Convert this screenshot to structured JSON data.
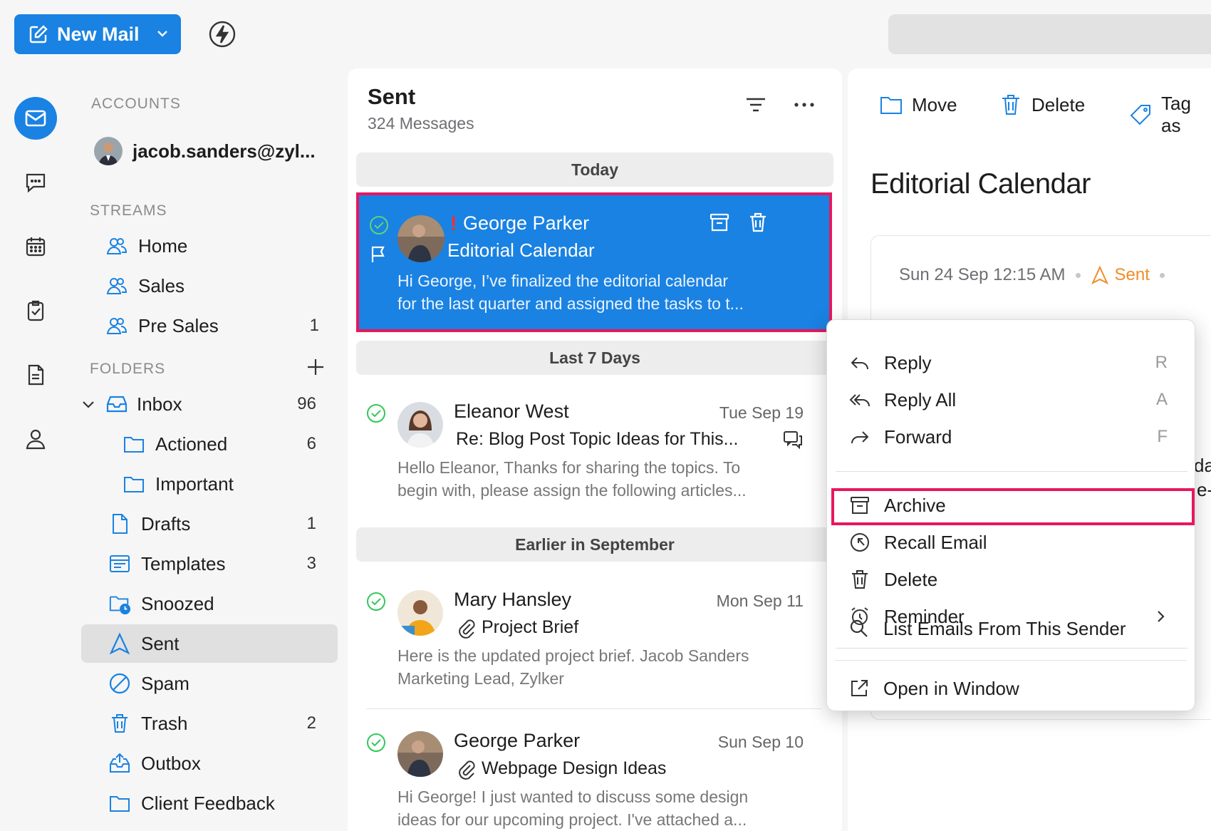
{
  "toolbar": {
    "new_mail_label": "New Mail"
  },
  "sidebar": {
    "accounts_header": "ACCOUNTS",
    "account_email": "jacob.sanders@zyl...",
    "streams_header": "STREAMS",
    "streams": [
      {
        "label": "Home",
        "count": ""
      },
      {
        "label": "Sales",
        "count": ""
      },
      {
        "label": "Pre Sales",
        "count": "1"
      }
    ],
    "folders_header": "FOLDERS",
    "folders": [
      {
        "label": "Inbox",
        "count": "96"
      },
      {
        "label": "Actioned",
        "count": "6"
      },
      {
        "label": "Important",
        "count": ""
      },
      {
        "label": "Drafts",
        "count": "1"
      },
      {
        "label": "Templates",
        "count": "3"
      },
      {
        "label": "Snoozed",
        "count": ""
      },
      {
        "label": "Sent",
        "count": ""
      },
      {
        "label": "Spam",
        "count": ""
      },
      {
        "label": "Trash",
        "count": "2"
      },
      {
        "label": "Outbox",
        "count": ""
      },
      {
        "label": "Client Feedback",
        "count": ""
      }
    ]
  },
  "list": {
    "title": "Sent",
    "subtitle": "324 Messages",
    "groups": [
      "Today",
      "Last 7 Days",
      "Earlier in September"
    ],
    "messages": [
      {
        "sender": "George Parker",
        "subject": "Editorial Calendar",
        "preview1": "Hi George, I’ve finalized the editorial calendar",
        "preview2": "for the last quarter and assigned the tasks to t...",
        "date": "",
        "important_mark": "!"
      },
      {
        "sender": "Eleanor West",
        "subject": "Re: Blog Post Topic Ideas for This...",
        "preview1": "Hello Eleanor, Thanks for sharing the topics. To",
        "preview2": "begin with, please assign the following articles...",
        "date": "Tue Sep 19"
      },
      {
        "sender": "Mary Hansley",
        "subject": "Project Brief",
        "preview1": "Here is the updated project brief. Jacob Sanders",
        "preview2": "Marketing Lead, Zylker",
        "date": "Mon Sep 11"
      },
      {
        "sender": "George Parker",
        "subject": "Webpage Design Ideas",
        "preview1": "Hi George! I just wanted to discuss some design",
        "preview2": "ideas for our upcoming project. I've attached a...",
        "date": "Sun Sep 10"
      }
    ]
  },
  "reading": {
    "tools": {
      "move": "Move",
      "delete": "Delete",
      "tag": "Tag as"
    },
    "title": "Editorial Calendar",
    "date": "Sun 24 Sep 12:15 AM",
    "status": "Sent",
    "cut1": "da",
    "cut2": "e-"
  },
  "context_menu": {
    "items": [
      {
        "label": "Reply",
        "key": "R"
      },
      {
        "label": "Reply All",
        "key": "A"
      },
      {
        "label": "Forward",
        "key": "F"
      },
      {
        "label": "Archive",
        "key": ""
      },
      {
        "label": "Recall Email",
        "key": ""
      },
      {
        "label": "Delete",
        "key": ""
      },
      {
        "label": "Reminder",
        "key": ""
      },
      {
        "label": "List Emails From This Sender",
        "key": ""
      },
      {
        "label": "Open in Window",
        "key": ""
      }
    ],
    "highlighted": "Recall Email"
  },
  "colors": {
    "accent": "#1a82e2",
    "highlight_border": "#e8175d",
    "sent_orange": "#f28c28",
    "check_green": "#34c759"
  }
}
